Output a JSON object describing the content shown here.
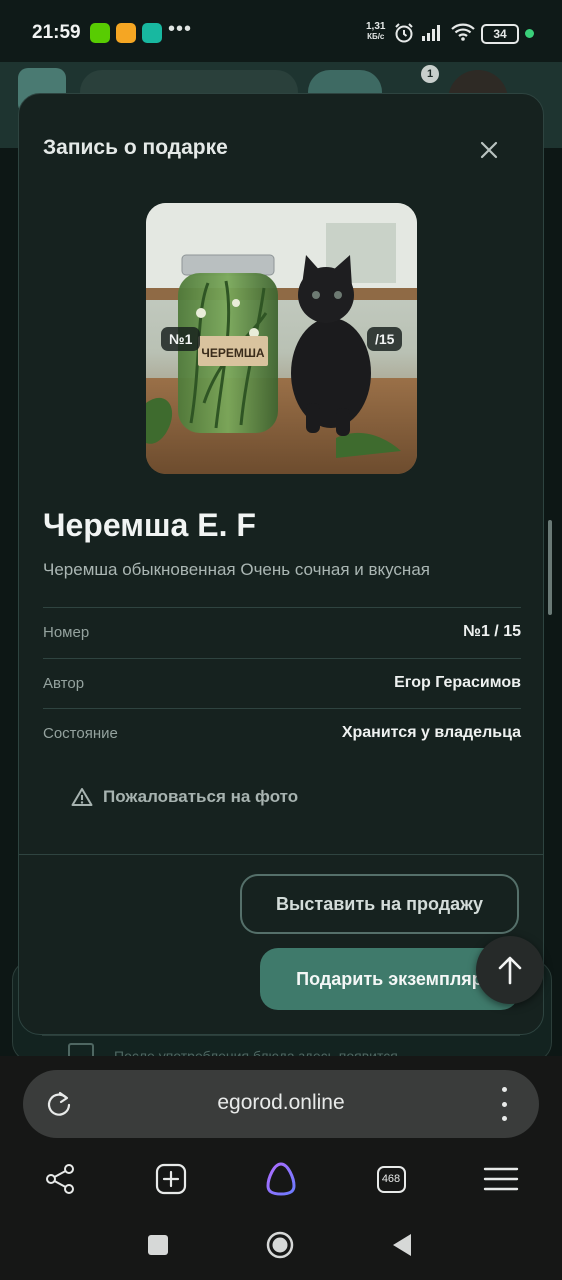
{
  "status_bar": {
    "time": "21:59",
    "net_speed_value": "1,31",
    "net_speed_unit": "КБ/с",
    "battery": "34",
    "icons": [
      "duolingo-app-icon",
      "notes-app-icon",
      "stack-app-icon",
      "more-dots",
      "alarm-icon",
      "signal-icon",
      "wifi-icon",
      "battery-icon"
    ]
  },
  "background": {
    "notification_count": "1",
    "faded_row_text": "После употребления блюда здесь появится"
  },
  "modal": {
    "title": "Запись о подарке",
    "close_icon": "close-icon",
    "image": {
      "jar_label": "ЧЕРЕМША",
      "chip_number": "№1",
      "chip_total": "/15"
    },
    "name": "Черемша E. F",
    "description": "Черемша обыкновенная Очень сочная и вкусная",
    "details": [
      {
        "label": "Номер",
        "value": "№1 / 15"
      },
      {
        "label": "Автор",
        "value": "Егор Герасимов"
      },
      {
        "label": "Состояние",
        "value": "Хранится у владельца"
      }
    ],
    "report_label": "Пожаловаться на фото",
    "sell_button": "Выставить на продажу",
    "gift_button": "Подарить экземпляр"
  },
  "browser": {
    "url": "egorod.online",
    "tab_count": "468",
    "nav_icons": [
      "share-icon",
      "new-tab-icon",
      "alice-icon",
      "tabs-icon",
      "menu-icon"
    ]
  },
  "colors": {
    "accent": "#3f7a6b",
    "modal_bg": "#16221f",
    "page_bg": "#0d1715"
  }
}
